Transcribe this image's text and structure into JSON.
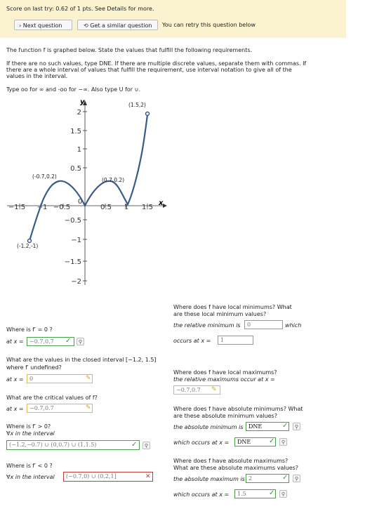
{
  "banner": {
    "score_text": "Score on last try: 0.62 of 1 pts. See Details for more.",
    "next_question": "› Next question",
    "similar_question": "Get a similar question",
    "retry_text": "You can retry this question below"
  },
  "instructions": {
    "line1": "The function f is graphed below. State the values that fulfill the following requirements.",
    "line2": "If there are no such values, type DNE. If there are multiple discrete values, separate them with commas. If",
    "line3": "there are a whole interval of values that fulfill the requirement, use interval notation to give all of the",
    "line4": "values in the interval.",
    "line5": "Type oo for ∞ and -oo for −∞. Also type U for ∪."
  },
  "graph": {
    "y_axis_label": "y",
    "x_axis_label": "x",
    "y_ticks": [
      "2",
      "1.5",
      "1",
      "0.5",
      "−0.5",
      "−1",
      "−1.5",
      "−2"
    ],
    "x_ticks": [
      "−1.5",
      "−1",
      "−0.5",
      "0",
      "0.5",
      "1",
      "1.5"
    ],
    "point_labels": [
      "(1.5,2)",
      "(-0.7,0.2)",
      "(0.7,0.2)",
      "(-1.2,-1)"
    ]
  },
  "left": {
    "q1": {
      "title": "Where is f′ = 0 ?",
      "prefix": "at x =",
      "answer": "−0.7,0.7"
    },
    "q2": {
      "title_a": "What are the values in the closed interval [−1.2, 1.5]",
      "title_b": "where f′ undefined?",
      "prefix": "at x =",
      "answer": "0"
    },
    "q3": {
      "title": "What are the critical values of f?",
      "prefix": "at x =",
      "answer": "−0.7,0.7"
    },
    "q4": {
      "title": "Where is f′ > 0?",
      "sub": "∀x in the interval",
      "answer": "(−1.2,−0.7) ∪ (0,0.7) ∪ (1,1.5)"
    },
    "q5": {
      "title": "Where is f′ < 0 ?",
      "prefix": "∀x in the interval",
      "answer": "(−0.7,0) ∪ (0.2,1]"
    }
  },
  "right": {
    "r1": {
      "title_a": "Where does f have local minimums? What",
      "title_b": "are these local minimum values?",
      "line1": "the relative minimum is",
      "answer1": "0",
      "which": "which",
      "line2": "occurs at x =",
      "answer2": "1"
    },
    "r2": {
      "title": "Where does f have local maximums?",
      "line1": "the relative maximums occur at x =",
      "answer1": "−0.7,0.7"
    },
    "r3": {
      "title_a": "Where does f have absolute minimums? What",
      "title_b": "are these absolute minimum values?",
      "line1": "the absolute minimum is",
      "answer1": "DNE",
      "line2": "which occurs at x =",
      "answer2": "DNE"
    },
    "r4": {
      "title_a": "Where does f have absolute maximums?",
      "title_b": "What are these absolute maximums values?",
      "line1": "the absolute maximum is",
      "answer1": "2",
      "line2": "which occurs at x =",
      "answer2": "1.5"
    }
  },
  "colors": {
    "banner": "#fbf3d0",
    "curve": "#3a5a8a",
    "correct": "#4aa04a",
    "partial": "#e6b84a",
    "wrong": "#c23a3a"
  }
}
